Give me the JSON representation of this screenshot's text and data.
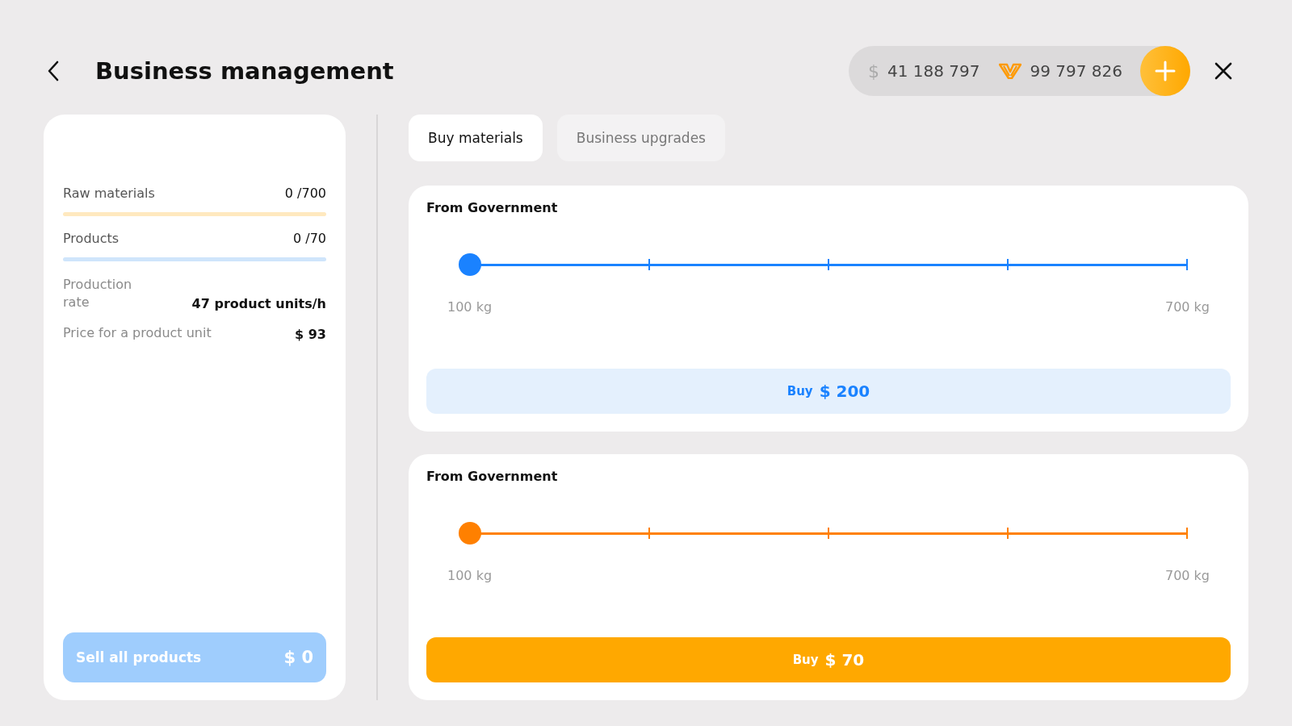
{
  "header": {
    "title": "Business management"
  },
  "balance": {
    "cash": "$",
    "cash_amount": "41 188 797",
    "coins_amount": "99 797 826"
  },
  "stats": [
    {
      "label": "Raw materials",
      "value": "0 /700",
      "level": 0,
      "color": "#ffe9bf"
    },
    {
      "label": "Products",
      "value": "0 /70",
      "level": 0,
      "color": "#cfe5fb"
    }
  ],
  "info": [
    {
      "label": "Production rate",
      "value": "47 product units/h"
    },
    {
      "label": "Price for a product unit",
      "value": "$ 93"
    }
  ],
  "sell_button": {
    "label": "Sell all products",
    "amount": "$ 0",
    "disabled": true
  },
  "tabs": [
    {
      "label": "Buy materials",
      "selected": true
    },
    {
      "label": "Business upgrades",
      "selected": false
    }
  ],
  "offers": [
    {
      "title": "From Government",
      "color": "#1a82ff",
      "level": 0,
      "min": "100 kg",
      "max": "700 kg",
      "button": {
        "kind": "soft",
        "label": "Buy",
        "price": "$ 200"
      }
    },
    {
      "title": "From Government",
      "color": "#ff8000",
      "level": 0,
      "min": "100 kg",
      "max": "700 kg",
      "button": {
        "kind": "solid",
        "label": "Buy",
        "price": "$ 70"
      }
    }
  ]
}
